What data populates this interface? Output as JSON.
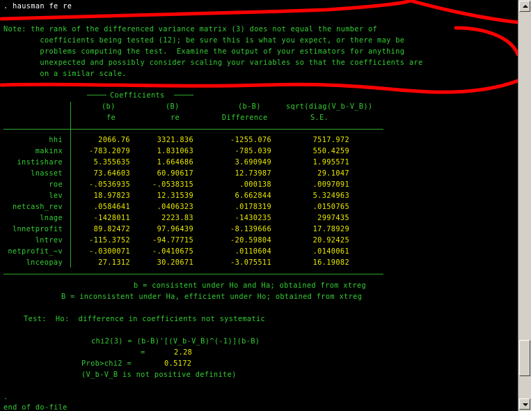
{
  "console": {
    "command": ". hausman fe re",
    "note_lines": [
      "Note: the rank of the differenced variance matrix (3) does not equal the number of",
      "        coefficients being tested (12); be sure this is what you expect, or there may be",
      "        problems computing the test.  Examine the output of your estimators for anything",
      "        unexpected and possibly consider scaling your variables so that the coefficients are",
      "        on a similar scale."
    ],
    "table": {
      "group_header": "Coefficients",
      "col_headers": [
        "(b)",
        "(B)",
        "(b-B)",
        "sqrt(diag(V_b-V_B))"
      ],
      "col_subheaders": [
        "fe",
        "re",
        "Difference",
        "S.E."
      ],
      "rows": [
        {
          "name": "hhi",
          "b": "2066.76",
          "B": "3321.836",
          "diff": "-1255.076",
          "se": "7517.972"
        },
        {
          "name": "makinx",
          "b": "-783.2079",
          "B": "1.831063",
          "diff": "-785.039",
          "se": "550.4259"
        },
        {
          "name": "instishare",
          "b": "5.355635",
          "B": "1.664686",
          "diff": "3.690949",
          "se": "1.995571"
        },
        {
          "name": "lnasset",
          "b": "73.64603",
          "B": "60.90617",
          "diff": "12.73987",
          "se": "29.1047"
        },
        {
          "name": "roe",
          "b": "-.0536935",
          "B": "-.0538315",
          "diff": ".000138",
          "se": ".0097091"
        },
        {
          "name": "lev",
          "b": "18.97823",
          "B": "12.31539",
          "diff": "6.662844",
          "se": "5.324963"
        },
        {
          "name": "netcash_rev",
          "b": ".0584641",
          "B": ".0406323",
          "diff": ".0178319",
          "se": ".0150765"
        },
        {
          "name": "lnage",
          "b": "-1428011",
          "B": "2223.83",
          "diff": "-1430235",
          "se": "2997435"
        },
        {
          "name": "lnnetprofit",
          "b": "89.82472",
          "B": "97.96439",
          "diff": "-8.139666",
          "se": "17.78929"
        },
        {
          "name": "lntrev",
          "b": "-115.3752",
          "B": "-94.77715",
          "diff": "-20.59804",
          "se": "20.92425"
        },
        {
          "name": "netprofit_~v",
          "b": "-.0300071",
          "B": "-.0410675",
          "diff": ".0110604",
          "se": ".0140061"
        },
        {
          "name": "lnceopay",
          "b": "27.1312",
          "B": "30.20671",
          "diff": "-3.075511",
          "se": "16.19082"
        }
      ]
    },
    "footer": {
      "b_def": "b = consistent under Ho and Ha; obtained from xtreg",
      "B_def": "B = inconsistent under Ha, efficient under Ho; obtained from xtreg",
      "test_line": "Test:  Ho:  difference in coefficients not systematic",
      "chi2_formula": "chi2(3) = (b-B)'[(V_b-V_B)^(-1)](b-B)",
      "chi2_eq": "=",
      "chi2_value": "2.28",
      "prob_label": "Prob>chi2 =",
      "prob_value": "0.5172",
      "vnote": "(V_b-V_B is not positive definite)"
    },
    "end_dot": ".",
    "end_line": "end of do-file"
  },
  "colors": {
    "background": "#000000",
    "command": "#ffffff",
    "text": "#33cc33",
    "values": "#e8e800",
    "annotation": "#ff0000"
  }
}
